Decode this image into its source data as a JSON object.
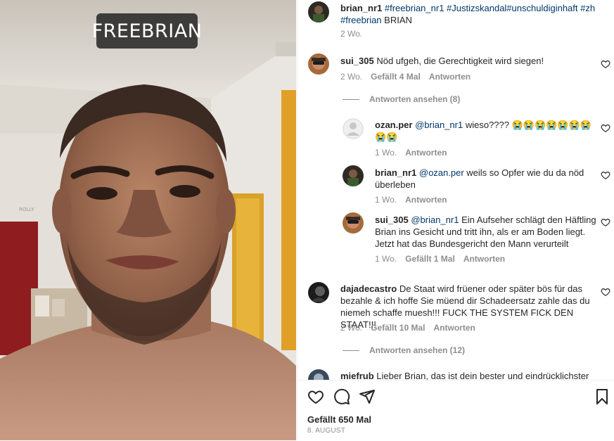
{
  "media": {
    "story_tag": "FREEBRIAN",
    "wall_sign": "ROLLY"
  },
  "post": {
    "caption": {
      "username": "brian_nr1",
      "text_parts": [
        "#freebrian_nr1 #Justizskandal#unschuldiginhaft #zh",
        "#freebrian",
        " BRIAN"
      ],
      "time": "2 Wo."
    },
    "comments": [
      {
        "username": "sui_305",
        "text": "Nöd ufgeh, die Gerechtigkeit wird siegen!",
        "time": "2 Wo.",
        "likes": "Gefällt 4 Mal",
        "reply": "Antworten",
        "view_replies": "Antworten ansehen (8)"
      },
      {
        "username": "ozan.per",
        "mention": "@brian_nr1",
        "text": " wieso????",
        "emoji_row1": "😭😭😭😭😭😭😭",
        "emoji_row2": "😭😭",
        "time": "1 Wo.",
        "reply": "Antworten"
      },
      {
        "username": "brian_nr1",
        "mention": "@ozan.per",
        "text_line1": " weils so Opfer wie du da nöd",
        "text_line2": "überleben",
        "time": "1 Wo.",
        "reply": "Antworten"
      },
      {
        "username": "sui_305",
        "mention": "@brian_nr1",
        "text_line1": " Ein Aufseher schlägt den Häftling",
        "text_line2": "Brian ins Gesicht und tritt ihn, als er am Boden liegt.",
        "text_line3": "Jetzt hat das Bundesgericht den Mann verurteilt",
        "time": "1 Wo.",
        "likes": "Gefällt 1 Mal",
        "reply": "Antworten"
      },
      {
        "username": "dajadecastro",
        "text_line1": " De Staat wird früener oder später bös für das",
        "text_line2": "bezahle & ich hoffe Sie müend dir Schadeersatz zahle das du",
        "text_line3": "niemeh schaffe muesh!!! FUCK THE SYSTEM FICK DEN STAAT!!!",
        "time": "2 Wo.",
        "likes": "Gefällt 10 Mal",
        "reply": "Antworten",
        "view_replies": "Antworten ansehen (12)"
      },
      {
        "username": "miefrub",
        "text": " Lieber Brian, das ist dein bester und eindrücklichster"
      }
    ],
    "actions": {
      "likes": "Gefällt 650 Mal",
      "date": "8. AUGUST"
    }
  },
  "colors": {
    "text": "#262626",
    "muted": "#8e8e8e",
    "link": "#00376b"
  }
}
